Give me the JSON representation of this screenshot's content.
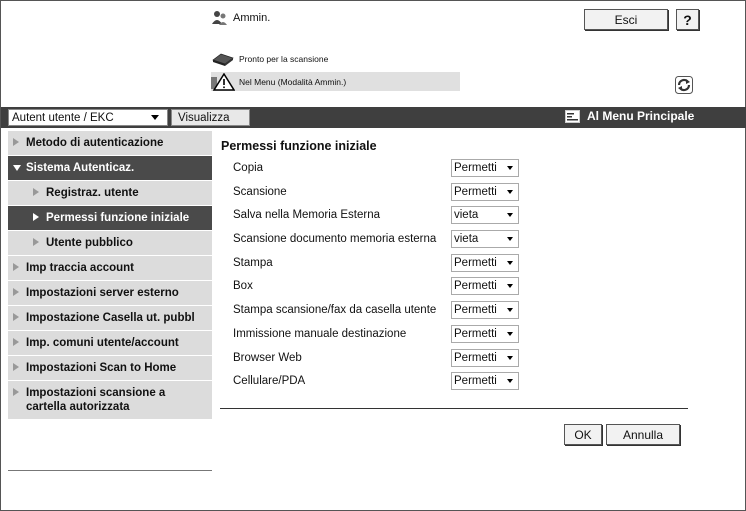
{
  "header": {
    "user_label": "Ammin.",
    "status_ready": "Pronto per la scansione",
    "status_mode": "Nel Menu (Modalità Ammin.)",
    "logout_label": "Esci",
    "help_label": "?"
  },
  "toolbar": {
    "view_select_value": "Autent utente / EKC",
    "view_button_label": "Visualizza",
    "main_menu_label": "Al Menu Principale"
  },
  "sidebar": {
    "items": [
      {
        "label": "Metodo di autenticazione"
      },
      {
        "label": "Sistema Autenticaz."
      },
      {
        "label": "Registraz. utente"
      },
      {
        "label": "Permessi funzione iniziale"
      },
      {
        "label": "Utente pubblico"
      },
      {
        "label": "Imp traccia account"
      },
      {
        "label": "Impostazioni server esterno"
      },
      {
        "label": "Impostazione Casella ut. pubbl"
      },
      {
        "label": "Imp. comuni utente/account"
      },
      {
        "label": "Impostazioni Scan to Home"
      },
      {
        "label": "Impostazioni scansione a cartella autorizzata"
      }
    ]
  },
  "main": {
    "title": "Permessi funzione iniziale",
    "rows": [
      {
        "label": "Copia",
        "value": "Permetti"
      },
      {
        "label": "Scansione",
        "value": "Permetti"
      },
      {
        "label": "Salva nella Memoria Esterna",
        "value": "vieta"
      },
      {
        "label": "Scansione documento memoria esterna",
        "value": "vieta"
      },
      {
        "label": "Stampa",
        "value": "Permetti"
      },
      {
        "label": "Box",
        "value": "Permetti"
      },
      {
        "label": "Stampa scansione/fax da casella utente",
        "value": "Permetti"
      },
      {
        "label": "Immissione manuale destinazione",
        "value": "Permetti"
      },
      {
        "label": "Browser Web",
        "value": "Permetti"
      },
      {
        "label": "Cellulare/PDA",
        "value": "Permetti"
      }
    ],
    "ok_label": "OK",
    "cancel_label": "Annulla"
  }
}
